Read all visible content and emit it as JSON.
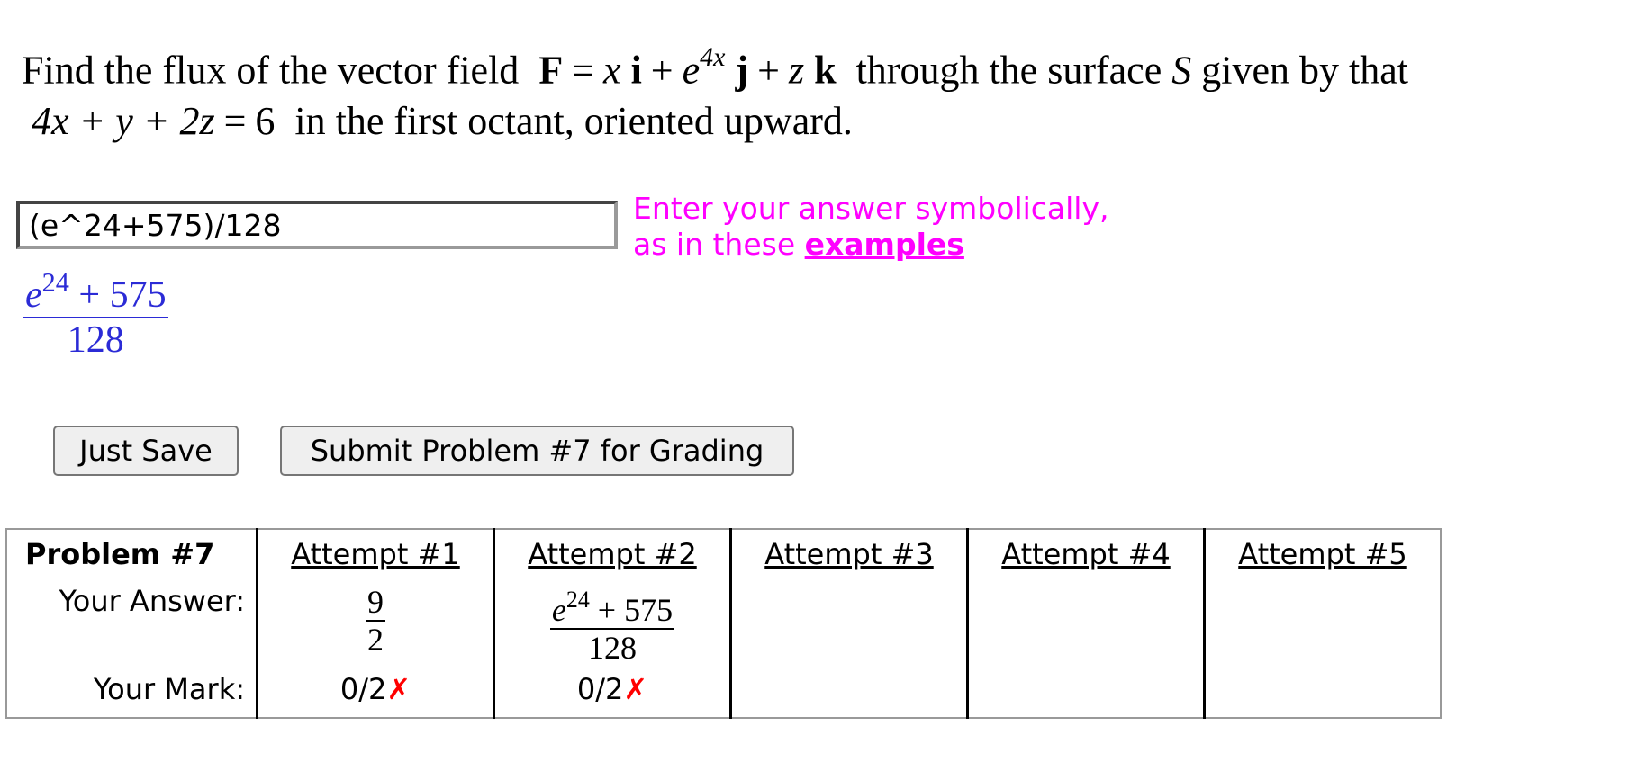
{
  "question": {
    "part1": "Find the flux of the vector field",
    "F": "F",
    "eq1": "=",
    "x": "x",
    "i": "i",
    "plus1": "+",
    "e": "e",
    "exp": "4x",
    "j": "j",
    "plus2": "+",
    "z": "z",
    "k": "k",
    "part2": "through the surface",
    "S": "S",
    "part3": "given by that",
    "eq_lhs": "4x + y + 2z",
    "eq2": "=",
    "eq_rhs": "6",
    "part4": "in the first octant, oriented upward."
  },
  "answer": {
    "value": "(e^24+575)/128",
    "preview_base": "e",
    "preview_exp": "24",
    "preview_rest": " + 575",
    "preview_den": "128"
  },
  "hint": {
    "line1": "Enter your answer symbolically,",
    "line2_prefix": "as in these ",
    "link": "examples"
  },
  "buttons": {
    "save": "Just Save",
    "submit": "Submit Problem #7 for Grading"
  },
  "table": {
    "problem_label": "Problem #7",
    "your_answer_label": "Your Answer:",
    "your_mark_label": "Your Mark:",
    "attempts": [
      {
        "label": "Attempt #1",
        "num": "9",
        "den": "2",
        "mark": "0/2",
        "x": "✗"
      },
      {
        "label": "Attempt #2",
        "base": "e",
        "exp": "24",
        "rest": " + 575",
        "den": "128",
        "mark": "0/2",
        "x": "✗"
      },
      {
        "label": "Attempt #3"
      },
      {
        "label": "Attempt #4"
      },
      {
        "label": "Attempt #5"
      }
    ]
  },
  "colors": {
    "hint": "#ff00ff",
    "preview": "#2b2bd6",
    "wrong_mark": "#ff0000"
  }
}
